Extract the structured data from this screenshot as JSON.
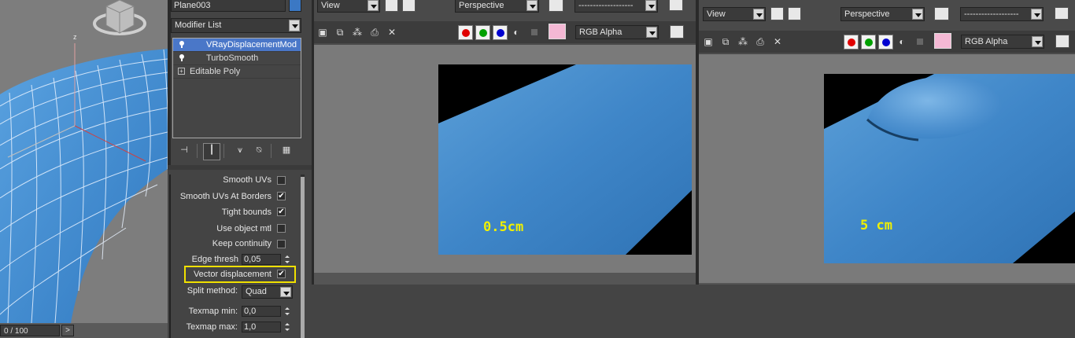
{
  "viewport": {
    "axis_z_label": "z",
    "time_slider": "0 / 100",
    "time_next_label": ">"
  },
  "command_panel": {
    "object_name": "Plane003",
    "object_color": "#3b78c4",
    "modifier_list_label": "Modifier List",
    "stack": [
      {
        "label": "VRayDisplacementMod",
        "selected": true,
        "icon": "lightbulb-icon"
      },
      {
        "label": "TurboSmooth",
        "selected": false,
        "icon": "lightbulb-icon"
      },
      {
        "label": "Editable Poly",
        "selected": false,
        "icon": "plus-icon"
      }
    ],
    "params": {
      "smooth_uvs": {
        "label": "Smooth UVs",
        "checked": false
      },
      "smooth_uvs_at_borders": {
        "label": "Smooth UVs At Borders",
        "checked": true
      },
      "tight_bounds": {
        "label": "Tight bounds",
        "checked": true
      },
      "use_object_mtl": {
        "label": "Use object mtl",
        "checked": false
      },
      "keep_continuity": {
        "label": "Keep continuity",
        "checked": false
      },
      "edge_thresh": {
        "label": "Edge thresh",
        "value": "0,05"
      },
      "vector_displacement": {
        "label": "Vector displacement",
        "checked": true,
        "highlight_color": "#f0e000"
      },
      "split_method": {
        "label": "Split method:",
        "value": "Quad"
      },
      "texmap_min": {
        "label": "Texmap min:",
        "value": "0,0"
      },
      "texmap_max": {
        "label": "Texmap max:",
        "value": "1,0"
      }
    },
    "check_mark": "✔"
  },
  "vfb_left": {
    "area_dropdown": "View",
    "camera_dropdown": "Perspective",
    "preset_dropdown": "-------------------",
    "channel_dropdown": "RGB Alpha",
    "render_label": "0.5cm",
    "swatch_color": "#f4b8d4"
  },
  "vfb_right": {
    "area_dropdown": "View",
    "camera_dropdown": "Perspective",
    "preset_dropdown": "-------------------",
    "channel_dropdown": "RGB Alpha",
    "render_label": "5 cm",
    "swatch_color": "#f4b8d4"
  },
  "colors": {
    "surface_blue": "#3f86c8",
    "label_yellow": "#f0f000",
    "selection_blue": "#4a77c8"
  }
}
